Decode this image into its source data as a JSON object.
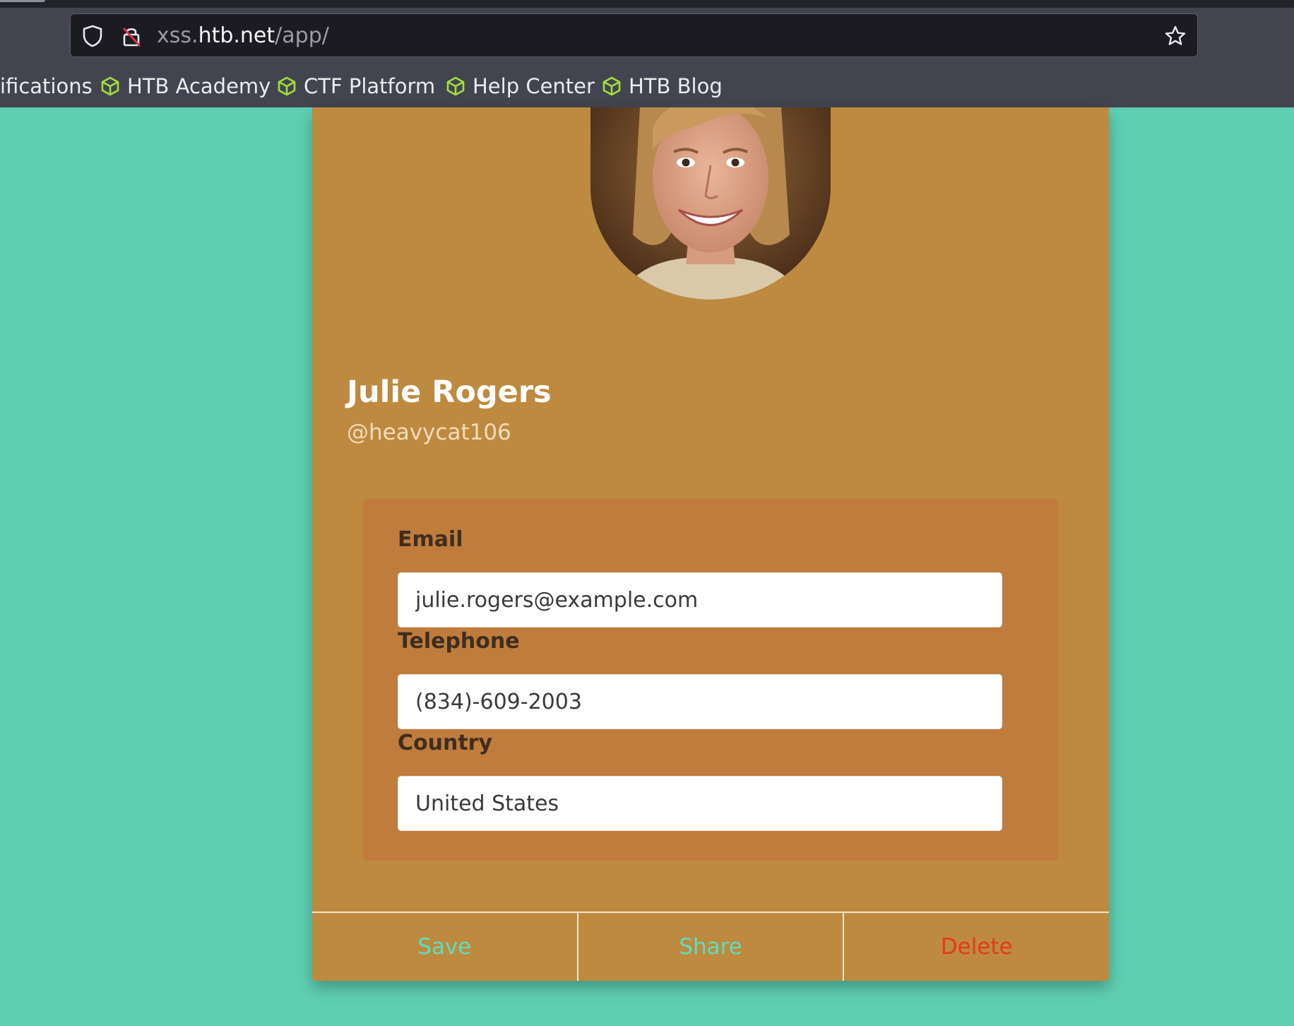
{
  "browser": {
    "url": {
      "scheme_sub": "xss.",
      "host": "htb.net",
      "path": "/app/"
    },
    "bookmarks": [
      {
        "label": "ifications",
        "icon": ""
      },
      {
        "label": "HTB Academy",
        "icon": "cube-icon"
      },
      {
        "label": "CTF Platform",
        "icon": "cube-icon"
      },
      {
        "label": "Help Center",
        "icon": "cube-icon"
      },
      {
        "label": "HTB Blog",
        "icon": "cube-icon"
      }
    ]
  },
  "profile": {
    "name": "Julie Rogers",
    "handle": "@heavycat106",
    "fields": {
      "email": {
        "label": "Email",
        "value": "julie.rogers@example.com"
      },
      "telephone": {
        "label": "Telephone",
        "value": "(834)-609-2003"
      },
      "country": {
        "label": "Country",
        "value": "United States"
      }
    },
    "actions": {
      "save": "Save",
      "share": "Share",
      "delete": "Delete"
    }
  },
  "colors": {
    "page_background": "#5fcfb2",
    "card_background": "#be8a3f",
    "details_background": "#c07c3c",
    "action_accent": "#5fdcc0",
    "delete_color": "#e23b1f",
    "bookmark_icon": "#a4e03a"
  }
}
